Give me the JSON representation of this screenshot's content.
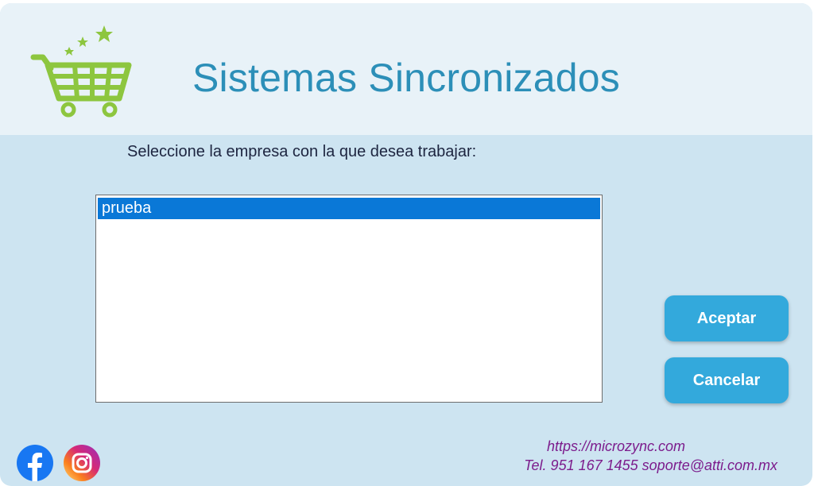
{
  "app": {
    "title": "Sistemas Sincronizados"
  },
  "prompt": "Seleccione la empresa con la que desea trabajar:",
  "companies": {
    "items": [
      {
        "label": "prueba",
        "selected": true
      }
    ]
  },
  "buttons": {
    "accept": "Aceptar",
    "cancel": "Cancelar"
  },
  "footer": {
    "website": "https://microzync.com",
    "contact": "Tel. 951 167 1455  soporte@atti.com.mx"
  },
  "icons": {
    "logo": "shopping-cart-icon",
    "facebook": "facebook-icon",
    "instagram": "instagram-icon"
  },
  "colors": {
    "header_bg": "#e8f2f8",
    "body_bg": "#cde4f1",
    "title": "#2c8fb8",
    "button": "#33a9dc",
    "selection": "#0a78d7",
    "footer_text": "#7c1c8c",
    "logo_green": "#8dc63f"
  }
}
